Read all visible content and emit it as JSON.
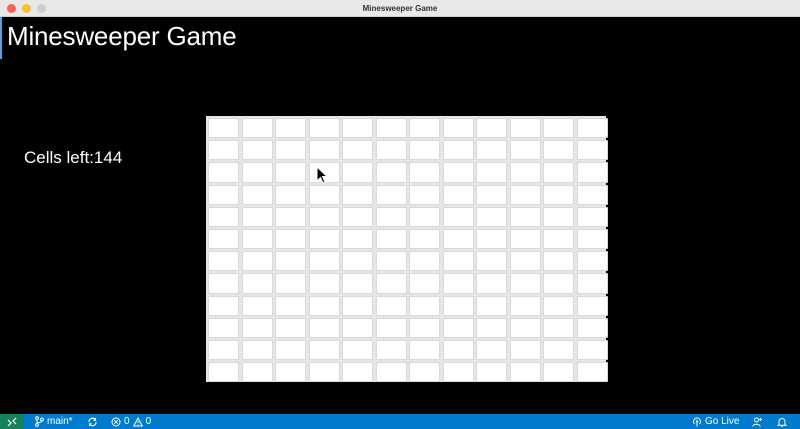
{
  "window": {
    "title": "Minesweeper Game"
  },
  "page": {
    "title": "Minesweeper Game",
    "cells_left_label": "Cells left:",
    "cells_left_value": "144"
  },
  "board": {
    "rows": 12,
    "cols": 12,
    "cell_state": "unrevealed"
  },
  "statusbar": {
    "branch": "main*",
    "errors": "0",
    "warnings": "0",
    "go_live": "Go Live",
    "icons": [
      "remote-icon",
      "branch-icon",
      "sync-icon",
      "error-icon",
      "warning-icon",
      "broadcast-icon",
      "account-icon",
      "bell-icon"
    ]
  },
  "colors": {
    "background": "#000000",
    "cell": "#ffffff",
    "cell_border": "#d9d9d9",
    "statusbar": "#007acc"
  }
}
